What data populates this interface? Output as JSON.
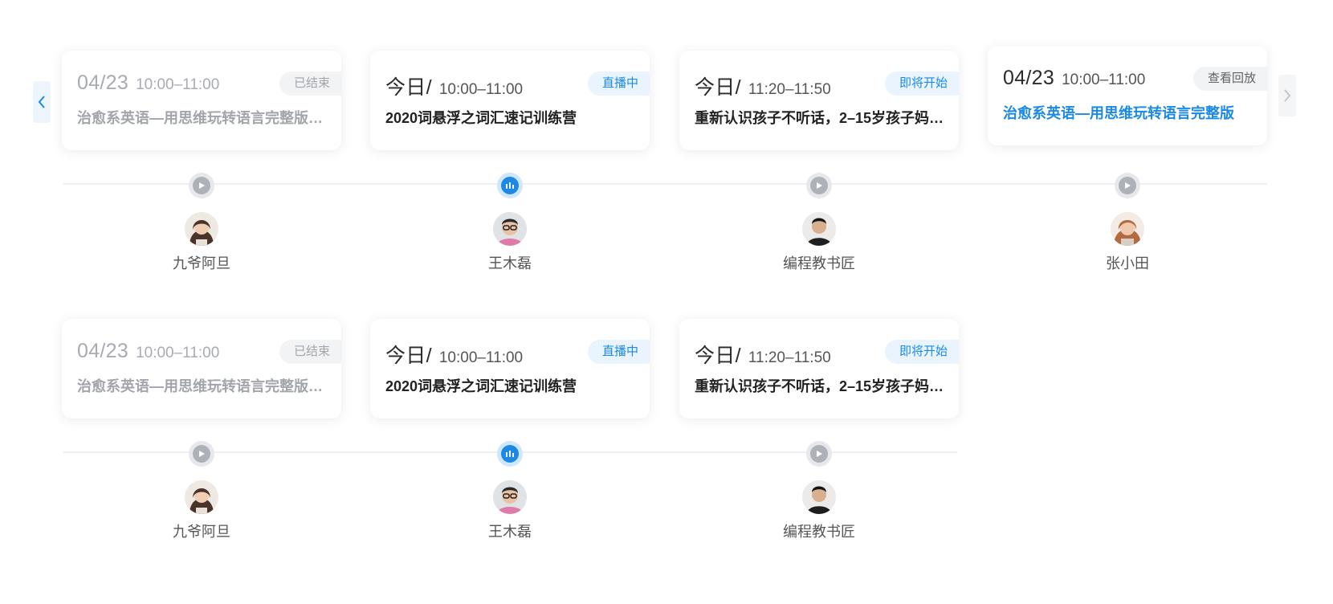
{
  "colors": {
    "accent": "#1a8ae6",
    "muted": "#a2a5ab",
    "text": "#222222"
  },
  "nav": {
    "prev_icon": "chevron-left-icon",
    "next_icon": "chevron-right-icon"
  },
  "rows": [
    {
      "items": [
        {
          "date": "04/23",
          "time": "10:00–11:00",
          "badge": "已结束",
          "title": "治愈系英语—用思维玩转语言完整版…",
          "status": "ended",
          "teacher": "九爷阿旦"
        },
        {
          "date": "今日/",
          "time": "10:00–11:00",
          "badge": "直播中",
          "title": "2020词悬浮之词汇速记训练营",
          "status": "live",
          "teacher": "王木磊"
        },
        {
          "date": "今日/",
          "time": "11:20–11:50",
          "badge": "即将开始",
          "title": "重新认识孩子不听话，2–15岁孩子妈…",
          "status": "soon",
          "teacher": "编程教书匠"
        },
        {
          "date": "04/23",
          "time": "10:00–11:00",
          "badge": "查看回放",
          "title": "治愈系英语—用思维玩转语言完整版",
          "status": "replay",
          "teacher": "张小田"
        }
      ]
    },
    {
      "items": [
        {
          "date": "04/23",
          "time": "10:00–11:00",
          "badge": "已结束",
          "title": "治愈系英语—用思维玩转语言完整版…",
          "status": "ended",
          "teacher": "九爷阿旦"
        },
        {
          "date": "今日/",
          "time": "10:00–11:00",
          "badge": "直播中",
          "title": "2020词悬浮之词汇速记训练营",
          "status": "live",
          "teacher": "王木磊"
        },
        {
          "date": "今日/",
          "time": "11:20–11:50",
          "badge": "即将开始",
          "title": "重新认识孩子不听话，2–15岁孩子妈…",
          "status": "soon",
          "teacher": "编程教书匠"
        }
      ]
    }
  ]
}
